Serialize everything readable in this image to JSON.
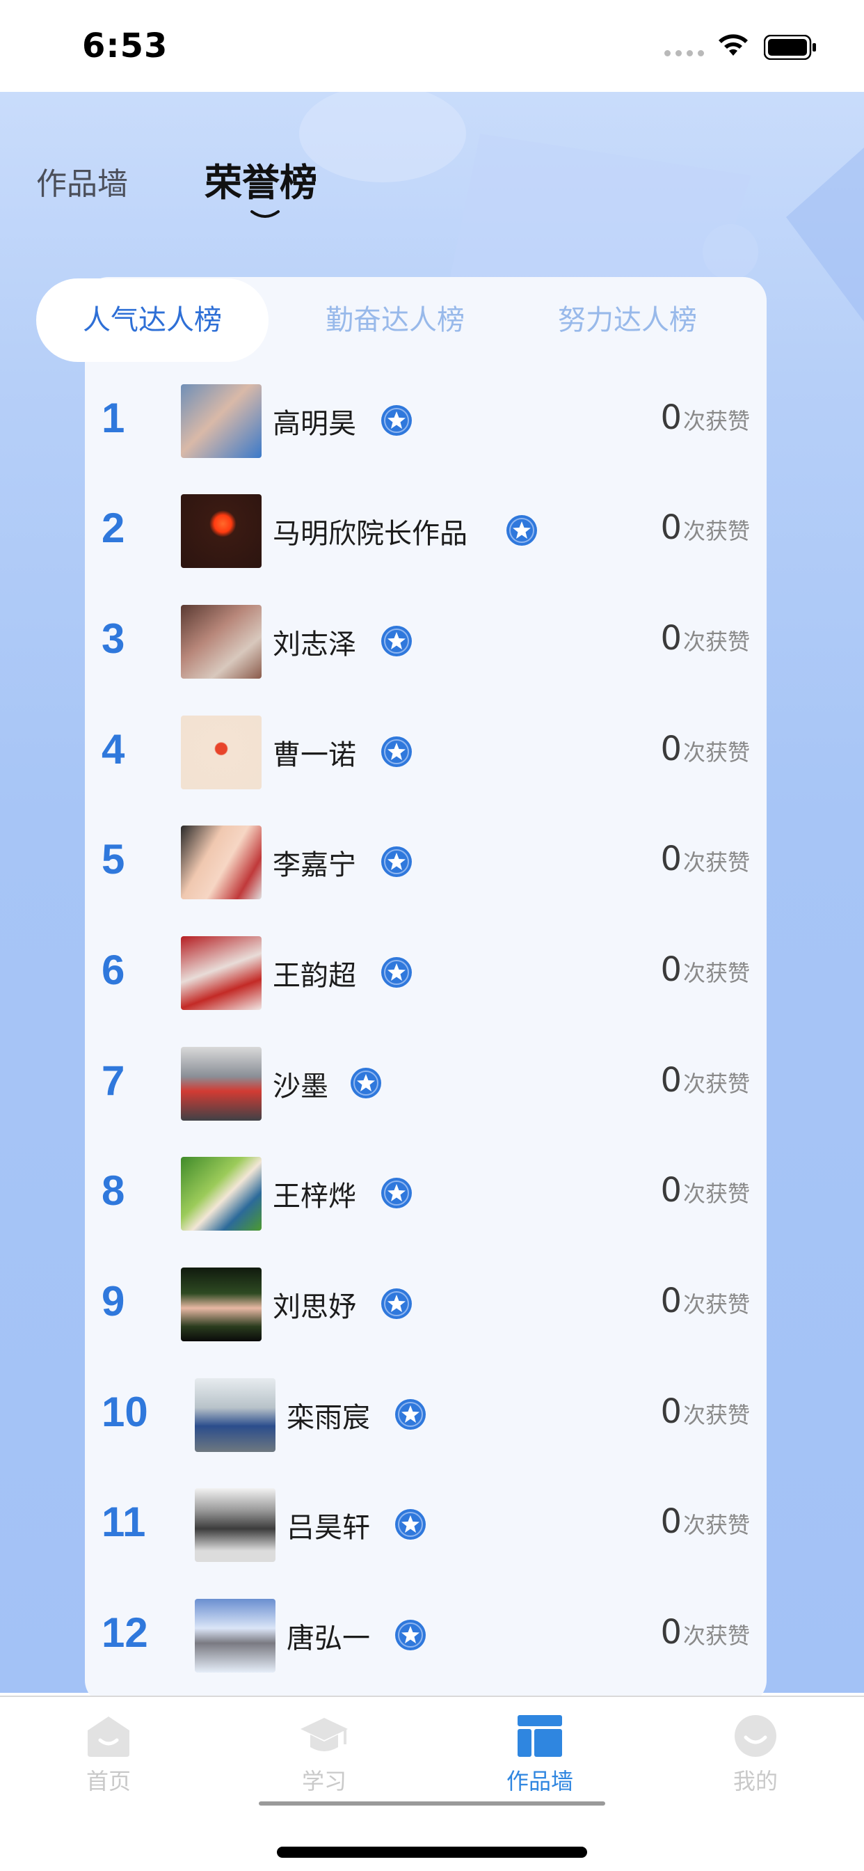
{
  "status_bar": {
    "time": "6:53"
  },
  "header": {
    "tab_works": "作品墙",
    "tab_honor": "荣誉榜"
  },
  "sub_tabs": [
    {
      "label": "人气达人榜",
      "active": true
    },
    {
      "label": "勤奋达人榜",
      "active": false
    },
    {
      "label": "努力达人榜",
      "active": false
    }
  ],
  "ranking": [
    {
      "rank": "1",
      "name": "高明昊",
      "likes": "0",
      "unit": "次获赞"
    },
    {
      "rank": "2",
      "name": "马明欣院长作品",
      "likes": "0",
      "unit": "次获赞"
    },
    {
      "rank": "3",
      "name": "刘志泽",
      "likes": "0",
      "unit": "次获赞"
    },
    {
      "rank": "4",
      "name": "曹一诺",
      "likes": "0",
      "unit": "次获赞"
    },
    {
      "rank": "5",
      "name": "李嘉宁",
      "likes": "0",
      "unit": "次获赞"
    },
    {
      "rank": "6",
      "name": "王韵超",
      "likes": "0",
      "unit": "次获赞"
    },
    {
      "rank": "7",
      "name": "沙墨",
      "likes": "0",
      "unit": "次获赞"
    },
    {
      "rank": "8",
      "name": "王梓烨",
      "likes": "0",
      "unit": "次获赞"
    },
    {
      "rank": "9",
      "name": "刘思妤",
      "likes": "0",
      "unit": "次获赞"
    },
    {
      "rank": "10",
      "name": "栾雨宸",
      "likes": "0",
      "unit": "次获赞"
    },
    {
      "rank": "11",
      "name": "吕昊轩",
      "likes": "0",
      "unit": "次获赞"
    },
    {
      "rank": "12",
      "name": "唐弘一",
      "likes": "0",
      "unit": "次获赞"
    }
  ],
  "tabbar": [
    {
      "label": "首页",
      "icon": "home-icon",
      "active": false
    },
    {
      "label": "学习",
      "icon": "graduation-cap-icon",
      "active": false
    },
    {
      "label": "作品墙",
      "icon": "works-wall-icon",
      "active": true
    },
    {
      "label": "我的",
      "icon": "profile-icon",
      "active": false
    }
  ],
  "colors": {
    "accent": "#2f78dc",
    "active_tab": "#2f86e0",
    "inactive_tab": "#c9c9c9",
    "hero_bg": "#a7c5f6"
  }
}
